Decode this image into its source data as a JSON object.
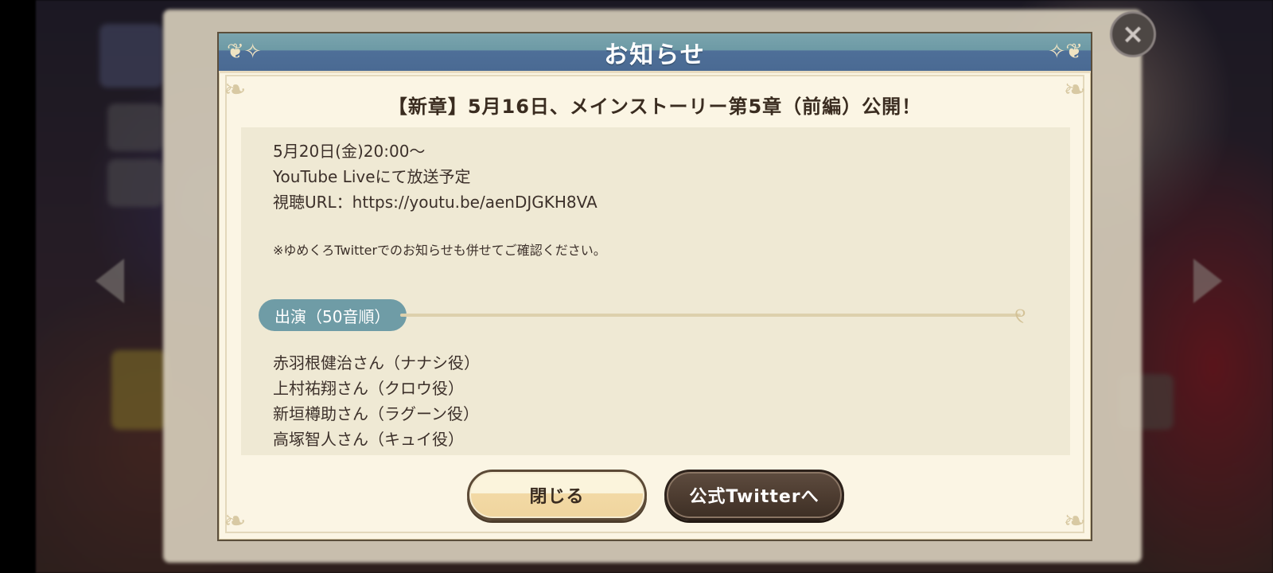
{
  "dialog": {
    "header_title": "お知らせ",
    "notice_title": "【新章】5月16日、メインストーリー第5章（前編）公開！",
    "body_lines": [
      "5月20日(金)20:00〜",
      "YouTube Liveにて放送予定",
      "視聴URL：https://youtu.be/aenDJGKH8VA"
    ],
    "note": "※ゆめくろTwitterでのお知らせも併せてご確認ください。",
    "section_label": "出演（50音順）",
    "cast": [
      "赤羽根健治さん（ナナシ役）",
      "上村祐翔さん（クロウ役）",
      "新垣樽助さん（ラグーン役）",
      "高塚智人さん（キュイ役）"
    ],
    "close_button": "閉じる",
    "twitter_button": "公式Twitterへ"
  },
  "background": {
    "close_icon": "close-icon"
  },
  "colors": {
    "header_teal": "#6d9aa5",
    "header_blue": "#4a6a93",
    "panel_cream": "#fbf5e4",
    "content_bg": "#efe9d4",
    "pill": "#6f9ca6",
    "dark_button": "#4e3d31"
  }
}
